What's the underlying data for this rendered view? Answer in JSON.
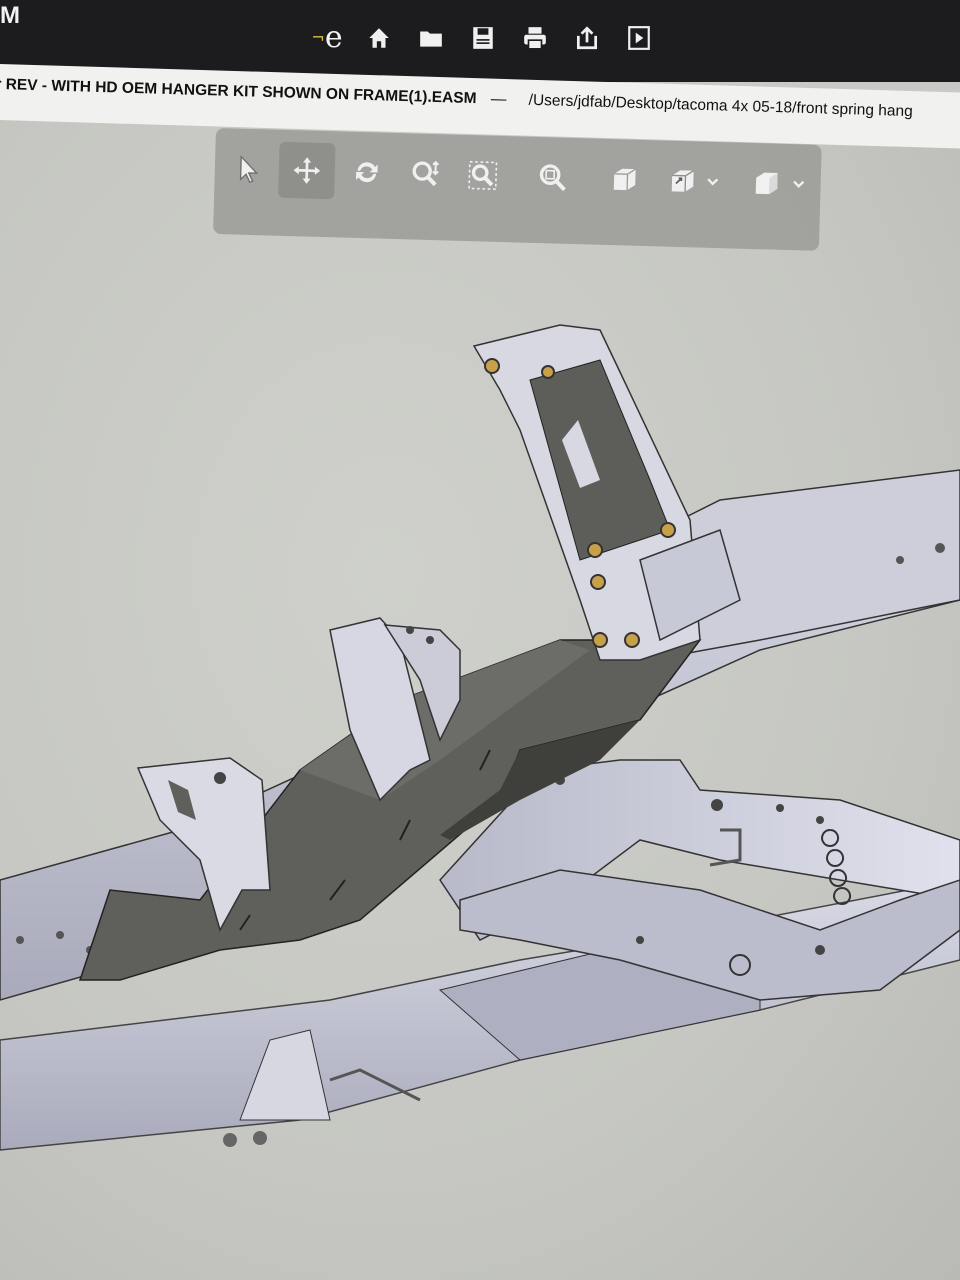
{
  "app": {
    "title_fragment": "M"
  },
  "document": {
    "name": "r REV - WITH HD OEM HANGER KIT SHOWN ON FRAME(1).EASM",
    "separator": "—",
    "path": "/Users/jdfab/Desktop/tacoma 4x 05-18/front spring hang"
  },
  "top_icons": [
    "edrawings-logo-icon",
    "home-icon",
    "open-folder-icon",
    "save-icon",
    "print-icon",
    "share-icon",
    "play-icon"
  ],
  "toolbar": {
    "tools": [
      "select-arrow-icon",
      "pan-icon",
      "rotate-icon",
      "zoom-icon",
      "zoom-to-area-icon",
      "zoom-to-fit-icon",
      "view-cube-icon",
      "view-orientation-icon",
      "display-style-icon"
    ],
    "active_tool": "pan-icon"
  },
  "colors": {
    "titlebar": "#1c1c1e",
    "viewport": "#c9cac6",
    "frame_steel": "#c4c5d4",
    "bracket_dark": "#5a5b56",
    "bolt_gold": "#c9a04a"
  }
}
